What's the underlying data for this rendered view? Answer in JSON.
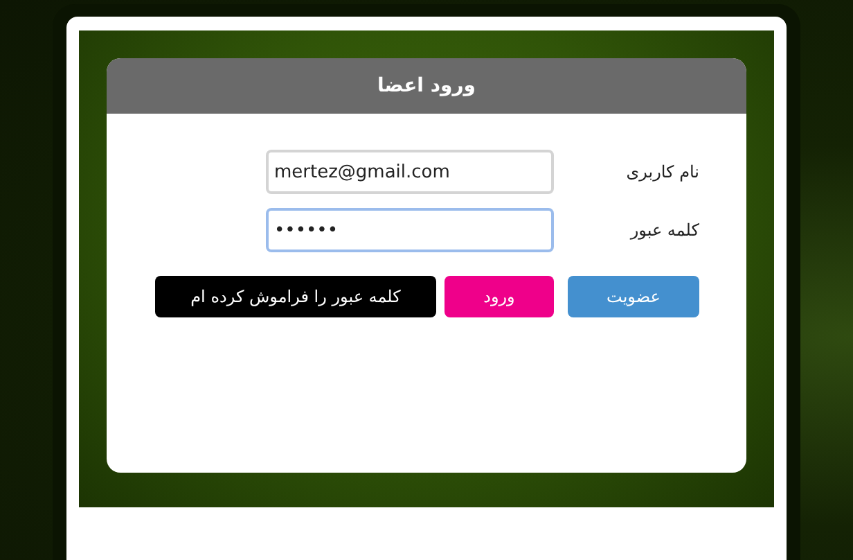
{
  "panel": {
    "title": "ورود اعضا"
  },
  "fields": [
    {
      "label": "نام کاربری",
      "value": "mertez@gmail.com",
      "focused": false
    },
    {
      "label": "کلمه عبور",
      "value": "••••••",
      "focused": true
    }
  ],
  "buttons": [
    {
      "label": "عضویت",
      "kind": "signup"
    },
    {
      "label": "ورود",
      "kind": "login"
    },
    {
      "label": "کلمه عبور را فراموش کرده ام",
      "kind": "forgot"
    }
  ]
}
